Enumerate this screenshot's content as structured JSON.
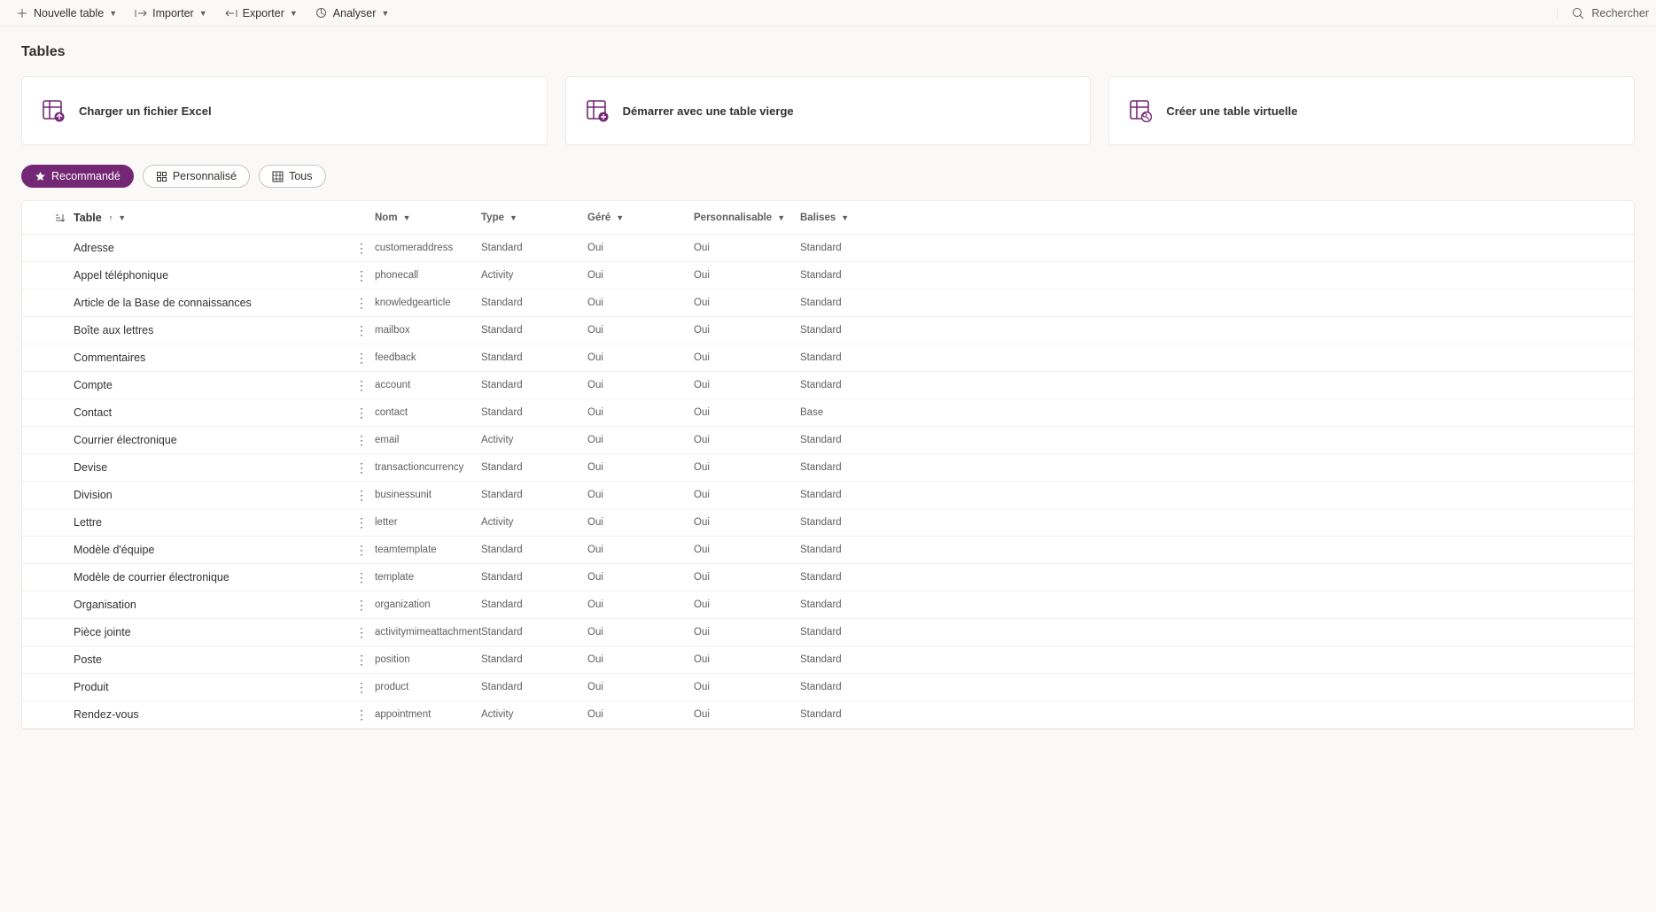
{
  "commandBar": {
    "newTable": "Nouvelle table",
    "import": "Importer",
    "export": "Exporter",
    "analyze": "Analyser",
    "search": "Rechercher"
  },
  "pageTitle": "Tables",
  "cards": {
    "uploadExcel": "Charger un fichier Excel",
    "startBlank": "Démarrer avec une table vierge",
    "createVirtual": "Créer une table virtuelle"
  },
  "pills": {
    "recommended": "Recommandé",
    "custom": "Personnalisé",
    "all": "Tous"
  },
  "columns": {
    "table": "Table",
    "nom": "Nom",
    "type": "Type",
    "gere": "Géré",
    "personnalisable": "Personnalisable",
    "balises": "Balises"
  },
  "rows": [
    {
      "table": "Adresse",
      "nom": "customeraddress",
      "type": "Standard",
      "gere": "Oui",
      "perso": "Oui",
      "balises": "Standard"
    },
    {
      "table": "Appel téléphonique",
      "nom": "phonecall",
      "type": "Activity",
      "gere": "Oui",
      "perso": "Oui",
      "balises": "Standard"
    },
    {
      "table": "Article de la Base de connaissances",
      "nom": "knowledgearticle",
      "type": "Standard",
      "gere": "Oui",
      "perso": "Oui",
      "balises": "Standard"
    },
    {
      "table": "Boîte aux lettres",
      "nom": "mailbox",
      "type": "Standard",
      "gere": "Oui",
      "perso": "Oui",
      "balises": "Standard"
    },
    {
      "table": "Commentaires",
      "nom": "feedback",
      "type": "Standard",
      "gere": "Oui",
      "perso": "Oui",
      "balises": "Standard"
    },
    {
      "table": "Compte",
      "nom": "account",
      "type": "Standard",
      "gere": "Oui",
      "perso": "Oui",
      "balises": "Standard"
    },
    {
      "table": "Contact",
      "nom": "contact",
      "type": "Standard",
      "gere": "Oui",
      "perso": "Oui",
      "balises": "Base"
    },
    {
      "table": "Courrier électronique",
      "nom": "email",
      "type": "Activity",
      "gere": "Oui",
      "perso": "Oui",
      "balises": "Standard"
    },
    {
      "table": "Devise",
      "nom": "transactioncurrency",
      "type": "Standard",
      "gere": "Oui",
      "perso": "Oui",
      "balises": "Standard"
    },
    {
      "table": "Division",
      "nom": "businessunit",
      "type": "Standard",
      "gere": "Oui",
      "perso": "Oui",
      "balises": "Standard"
    },
    {
      "table": "Lettre",
      "nom": "letter",
      "type": "Activity",
      "gere": "Oui",
      "perso": "Oui",
      "balises": "Standard"
    },
    {
      "table": "Modèle d'équipe",
      "nom": "teamtemplate",
      "type": "Standard",
      "gere": "Oui",
      "perso": "Oui",
      "balises": "Standard"
    },
    {
      "table": "Modèle de courrier électronique",
      "nom": "template",
      "type": "Standard",
      "gere": "Oui",
      "perso": "Oui",
      "balises": "Standard"
    },
    {
      "table": "Organisation",
      "nom": "organization",
      "type": "Standard",
      "gere": "Oui",
      "perso": "Oui",
      "balises": "Standard"
    },
    {
      "table": "Pièce jointe",
      "nom": "activitymimeattachment",
      "type": "Standard",
      "gere": "Oui",
      "perso": "Oui",
      "balises": "Standard"
    },
    {
      "table": "Poste",
      "nom": "position",
      "type": "Standard",
      "gere": "Oui",
      "perso": "Oui",
      "balises": "Standard"
    },
    {
      "table": "Produit",
      "nom": "product",
      "type": "Standard",
      "gere": "Oui",
      "perso": "Oui",
      "balises": "Standard"
    },
    {
      "table": "Rendez-vous",
      "nom": "appointment",
      "type": "Activity",
      "gere": "Oui",
      "perso": "Oui",
      "balises": "Standard"
    }
  ]
}
